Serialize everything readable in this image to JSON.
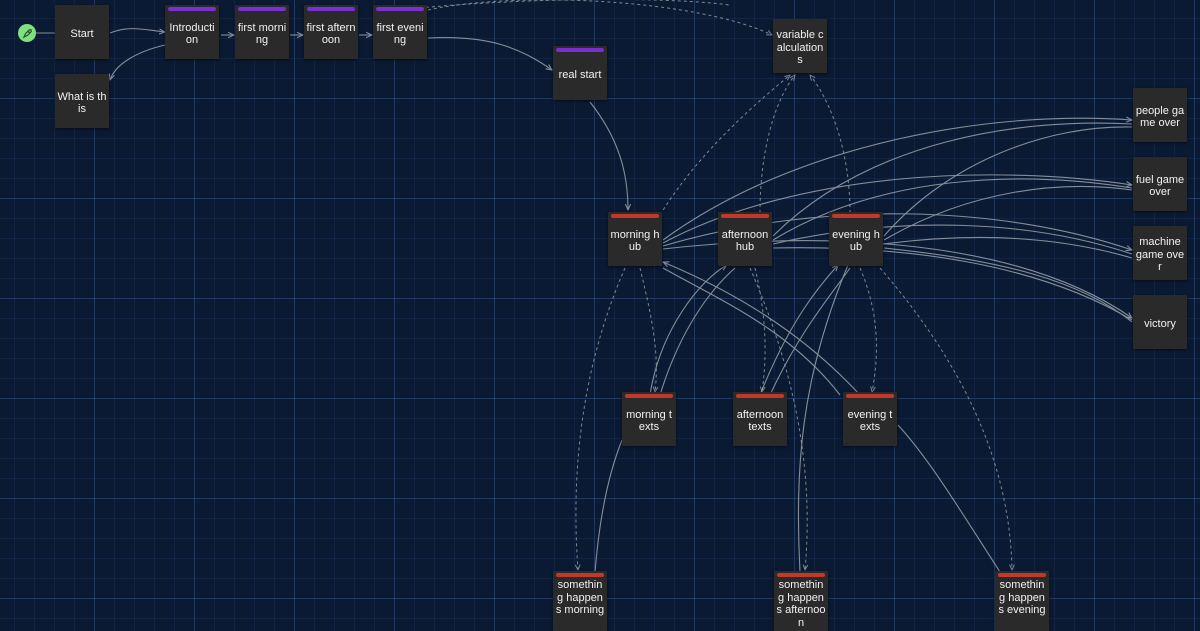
{
  "colors": {
    "background": "#0b1a33",
    "node": "#2a2a2a",
    "tag_purple": "#7a2fd1",
    "tag_red": "#c0392b",
    "link": "#9aa3ad",
    "start_dot": "#7ee07e"
  },
  "start_icon": "rocket-icon",
  "nodes": {
    "start": {
      "label": "Start"
    },
    "what_is_this": {
      "label": "What is this"
    },
    "introduction": {
      "label": "Introduction"
    },
    "first_morning": {
      "label": "first morning"
    },
    "first_afternoon": {
      "label": "first afternoon"
    },
    "first_evening": {
      "label": "first evening"
    },
    "real_start": {
      "label": "real start"
    },
    "variable_calculations": {
      "label": "variable calculations"
    },
    "morning_hub": {
      "label": "morning hub"
    },
    "afternoon_hub": {
      "label": "afternoon hub"
    },
    "evening_hub": {
      "label": "evening hub"
    },
    "people_game_over": {
      "label": "people game over"
    },
    "fuel_game_over": {
      "label": "fuel game over"
    },
    "machine_game_over": {
      "label": "machine game over"
    },
    "victory": {
      "label": "victory"
    },
    "morning_texts": {
      "label": "morning texts"
    },
    "afternoon_texts": {
      "label": "afternoon texts"
    },
    "evening_texts": {
      "label": "evening texts"
    },
    "something_happens_morning": {
      "label": "something happens morning"
    },
    "something_happens_afternoon": {
      "label": "something happens afternoon"
    },
    "something_happens_evening": {
      "label": "something happens evening"
    }
  }
}
